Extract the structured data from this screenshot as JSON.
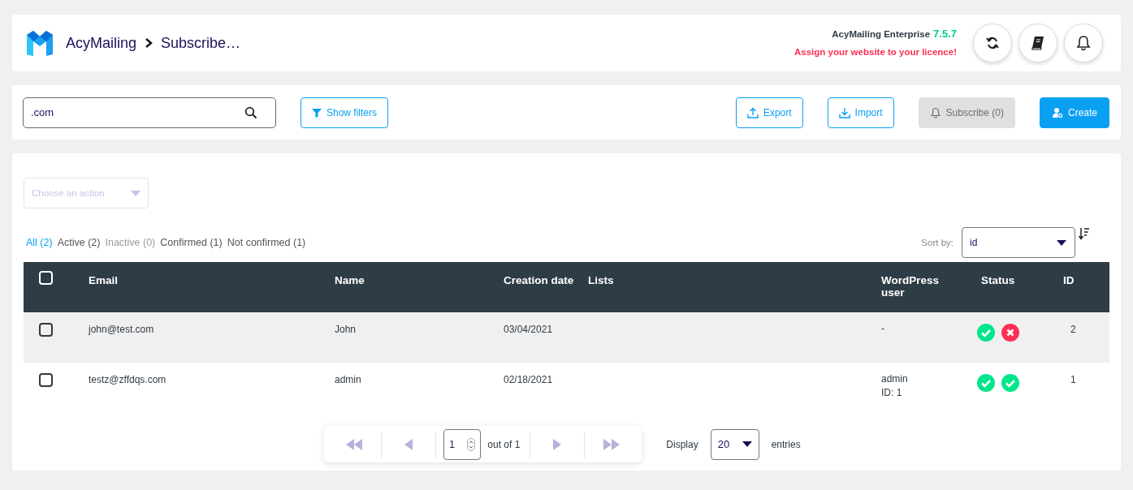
{
  "header": {
    "breadcrumb": [
      "AcyMailing",
      "Subscribe…"
    ],
    "edition": "AcyMailing Enterprise",
    "version": "7.5.7",
    "licence_warning": "Assign your website to your licence!"
  },
  "toolbar": {
    "search": {
      "value": ".com"
    },
    "filters_button": "Show filters",
    "buttons": [
      {
        "kind": "export",
        "label": "Export",
        "disabled": false
      },
      {
        "kind": "import",
        "label": "Import",
        "disabled": false
      },
      {
        "kind": "subscribe",
        "label": "Subscribe (0)",
        "disabled": true
      },
      {
        "kind": "create",
        "label": "Create",
        "disabled": false
      }
    ]
  },
  "action_select": {
    "placeholder": "Choose an action"
  },
  "status_filters": [
    {
      "label": "All (2)",
      "selected": true,
      "disabled": false
    },
    {
      "label": "Active (2)",
      "selected": false,
      "disabled": false
    },
    {
      "label": "Inactive (0)",
      "selected": false,
      "disabled": true
    },
    {
      "label": "Confirmed (1)",
      "selected": false,
      "disabled": false
    },
    {
      "label": "Not confirmed (1)",
      "selected": false,
      "disabled": false
    }
  ],
  "sort": {
    "label": "Sort by:",
    "value": "id"
  },
  "table": {
    "select_all_checked": false,
    "columns": [
      "Email",
      "Name",
      "Creation date",
      "Lists",
      "WordPress user",
      "Status",
      "ID"
    ],
    "rows": [
      {
        "checked": false,
        "email": "john@test.com",
        "name": "John",
        "created": "03/04/2021",
        "wp_user": [
          "-"
        ],
        "active": true,
        "confirmed": false,
        "id": "2"
      },
      {
        "checked": false,
        "email": "testz@zffdqs.com",
        "name": "admin",
        "created": "02/18/2021",
        "wp_user": [
          "admin",
          "ID: 1"
        ],
        "active": true,
        "confirmed": true,
        "id": "1"
      }
    ]
  },
  "pagination": {
    "page": "1",
    "out_of": "out of 1",
    "display_label": "Display",
    "per_page": "20",
    "entries_label": "entries"
  }
}
